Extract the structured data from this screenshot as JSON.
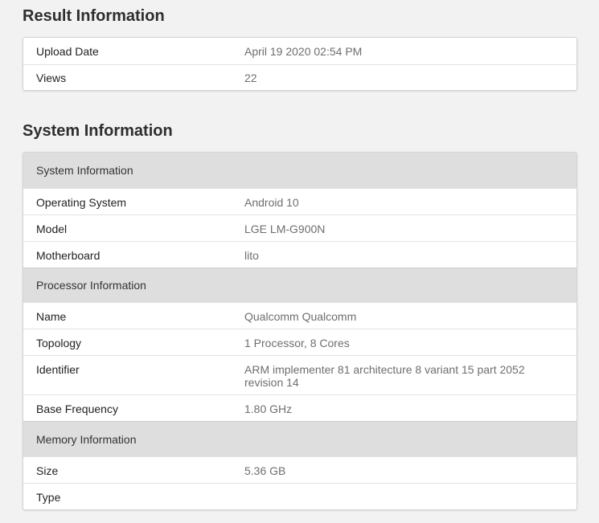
{
  "result_info": {
    "title": "Result Information",
    "rows": [
      {
        "label": "Upload Date",
        "value": "April 19 2020 02:54 PM"
      },
      {
        "label": "Views",
        "value": "22"
      }
    ]
  },
  "system_info": {
    "title": "System Information",
    "groups": [
      {
        "header": "System Information",
        "rows": [
          {
            "label": "Operating System",
            "value": "Android 10"
          },
          {
            "label": "Model",
            "value": "LGE LM-G900N"
          },
          {
            "label": "Motherboard",
            "value": "lito"
          }
        ]
      },
      {
        "header": "Processor Information",
        "rows": [
          {
            "label": "Name",
            "value": "Qualcomm Qualcomm"
          },
          {
            "label": "Topology",
            "value": "1 Processor, 8 Cores"
          },
          {
            "label": "Identifier",
            "value": "ARM implementer 81 architecture 8 variant 15 part 2052 revision 14"
          },
          {
            "label": "Base Frequency",
            "value": "1.80 GHz"
          }
        ]
      },
      {
        "header": "Memory Information",
        "rows": [
          {
            "label": "Size",
            "value": "5.36 GB"
          },
          {
            "label": "Type",
            "value": ""
          }
        ]
      }
    ]
  }
}
